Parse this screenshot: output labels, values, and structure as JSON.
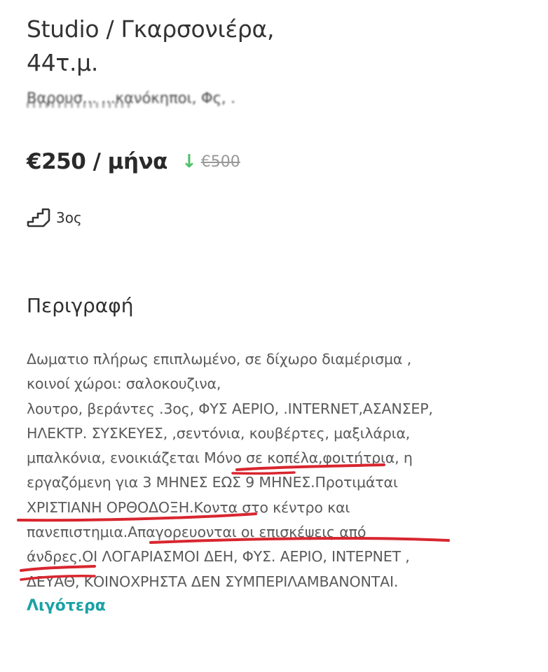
{
  "listing": {
    "title_line1": "Studio / Γκαρσονιέρα,",
    "title_line2": "44τ.μ.",
    "location": "Βαρουσ... ...κανόκηποι, Φς, .",
    "price": "€250 / μήνα",
    "price_drop_arrow": "↓",
    "old_price": "€500",
    "floor_icon": "stairs-icon",
    "floor": "3ος"
  },
  "description": {
    "heading": "Περιγραφή",
    "lines": [
      "Δωματιο πλήρως επιπλωμένο, σε δίχωρο διαμέρισμα ,",
      "κοινοί χώροι: σαλοκουζινα,",
      "λουτρο, βεράντες .3ος, ΦΥΣ ΑΕΡΙΟ, .INTERNET,ΑΣΑΝΣΕΡ,",
      "ΗΛΕΚΤΡ. ΣΥΣΚΕΥΕΣ, ,σεντόνια, κουβέρτες, μαξιλάρια,",
      "μπαλκόνια, ενοικιάζεται Μόνο σε κοπέλα,φοιτήτρια, η",
      "εργαζόμενη για 3 ΜΗΝΕΣ ΕΩΣ 9 ΜΗΝΕΣ.Προτιμάται",
      "ΧΡΙΣΤΙΑΝΗ ΟΡΘΟΔΟΞΗ.Κοντα στο κέντρο και",
      "πανεπιστημια.Απαγορευονται οι επισκέψεις από",
      "άνδρες.ΟΙ ΛΟΓΑΡΙΑΣΜΟΙ ΔΕΗ, ΦΥΣ. ΑΕΡΙΟ, ΙΝΤΕΡΝΕΤ ,",
      "ΔΕΥΑΘ, ΚΟΙΝΟΧΡΗΣΤΑ ΔΕΝ ΣΥΜΠΕΡΙΛΑΜΒΑΝΟΝΤΑΙ."
    ],
    "less_link": "Λιγότερα"
  },
  "colors": {
    "price_drop": "#4fc06a",
    "link": "#1aa2a6",
    "annotation": "#d8262f"
  }
}
